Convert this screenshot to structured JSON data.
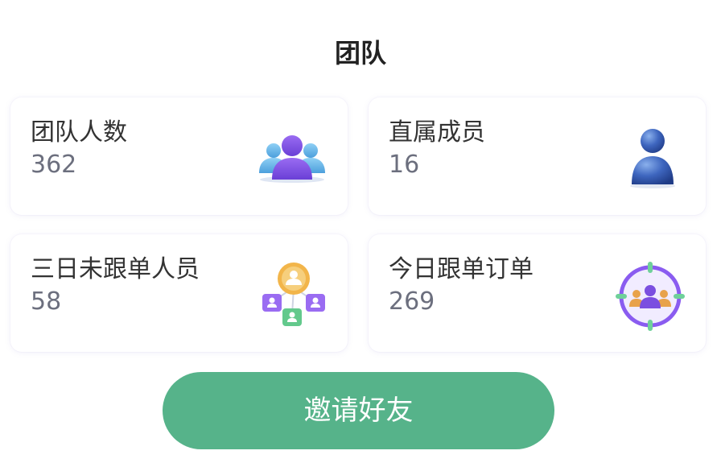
{
  "page": {
    "title": "团队"
  },
  "cards": [
    {
      "label": "团队人数",
      "value": "362",
      "icon": "team-group-icon"
    },
    {
      "label": "直属成员",
      "value": "16",
      "icon": "single-member-icon"
    },
    {
      "label": "三日未跟单人员",
      "value": "58",
      "icon": "network-members-icon"
    },
    {
      "label": "今日跟单订单",
      "value": "269",
      "icon": "target-team-icon"
    }
  ],
  "actions": {
    "invite_label": "邀请好友"
  },
  "colors": {
    "accent_green": "#56b38a",
    "value_gray": "#6c6f7e",
    "label_dark": "#333333",
    "icon_purple": "#7b4fe0",
    "icon_blue": "#5fb3e6",
    "icon_orange": "#e8a24a"
  }
}
